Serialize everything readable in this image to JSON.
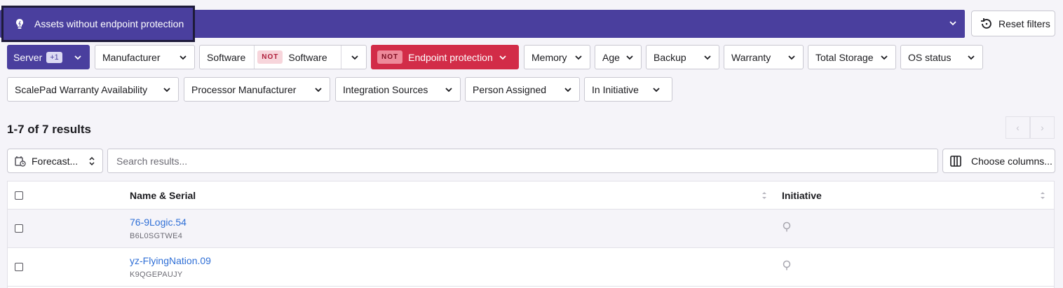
{
  "view": {
    "title": "Assets without endpoint protection",
    "icon": "lightbulb-icon"
  },
  "reset_label": "Reset filters",
  "filters": {
    "server": {
      "label": "Server",
      "badge": "+1"
    },
    "manufacturer": "Manufacturer",
    "software": {
      "label_left": "Software",
      "not": "NOT",
      "label_right": "Software"
    },
    "endpoint": {
      "not": "NOT",
      "label": "Endpoint protection"
    },
    "memory": "Memory",
    "age": "Age",
    "backup": "Backup",
    "warranty": "Warranty",
    "total_storage": "Total Storage",
    "os_status": "OS status",
    "scalepad_warranty": "ScalePad Warranty Availability",
    "processor_manufacturer": "Processor Manufacturer",
    "integration_sources": "Integration Sources",
    "person_assigned": "Person Assigned",
    "in_initiative": "In Initiative"
  },
  "results_text": "1-7 of 7 results",
  "toolbar": {
    "forecast_label": "Forecast...",
    "search_placeholder": "Search results...",
    "columns_label": "Choose columns..."
  },
  "table": {
    "headers": {
      "name": "Name & Serial",
      "initiative": "Initiative"
    },
    "rows": [
      {
        "name": "76-9Logic.54",
        "serial": "B6L0SGTWE4"
      },
      {
        "name": "yz-FlyingNation.09",
        "serial": "K9QGEPAUJY"
      }
    ]
  },
  "colors": {
    "primary": "#4a3f9e",
    "danger": "#d22c48",
    "link": "#2f6fd6"
  }
}
